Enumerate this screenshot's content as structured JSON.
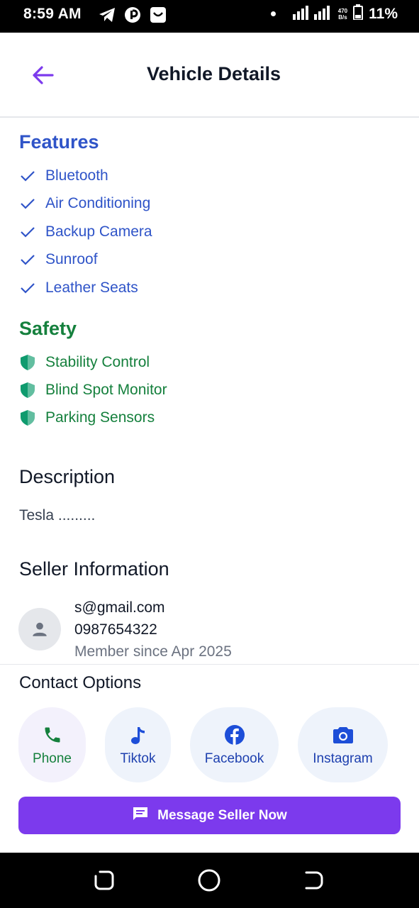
{
  "status_bar": {
    "time": "8:59 AM",
    "speed_top": "470",
    "speed_bottom": "B/s",
    "battery": "11%",
    "icons": [
      "telegram-icon",
      "app-icon",
      "shop-icon",
      "signal-icon",
      "battery-icon"
    ]
  },
  "header": {
    "title": "Vehicle Details",
    "back_icon": "arrow-left-icon",
    "accent": "#7c3aed"
  },
  "features": {
    "title": "Features",
    "color": "#2f54c8",
    "items": [
      "Bluetooth",
      "Air Conditioning",
      "Backup Camera",
      "Sunroof",
      "Leather Seats"
    ]
  },
  "safety": {
    "title": "Safety",
    "color": "#15803d",
    "items": [
      "Stability Control",
      "Blind Spot Monitor",
      "Parking Sensors"
    ]
  },
  "description": {
    "title": "Description",
    "text": "Tesla ........."
  },
  "seller": {
    "title": "Seller Information",
    "email": "s@gmail.com",
    "phone": "0987654322",
    "member_since": "Member  since Apr 2025"
  },
  "contact": {
    "title": "Contact Options",
    "options": [
      {
        "label": "Phone",
        "icon": "phone-icon"
      },
      {
        "label": "Tiktok",
        "icon": "tiktok-icon"
      },
      {
        "label": "Facebook",
        "icon": "facebook-icon"
      },
      {
        "label": "Instagram",
        "icon": "camera-icon"
      }
    ],
    "message_button": "Message Seller Now"
  }
}
